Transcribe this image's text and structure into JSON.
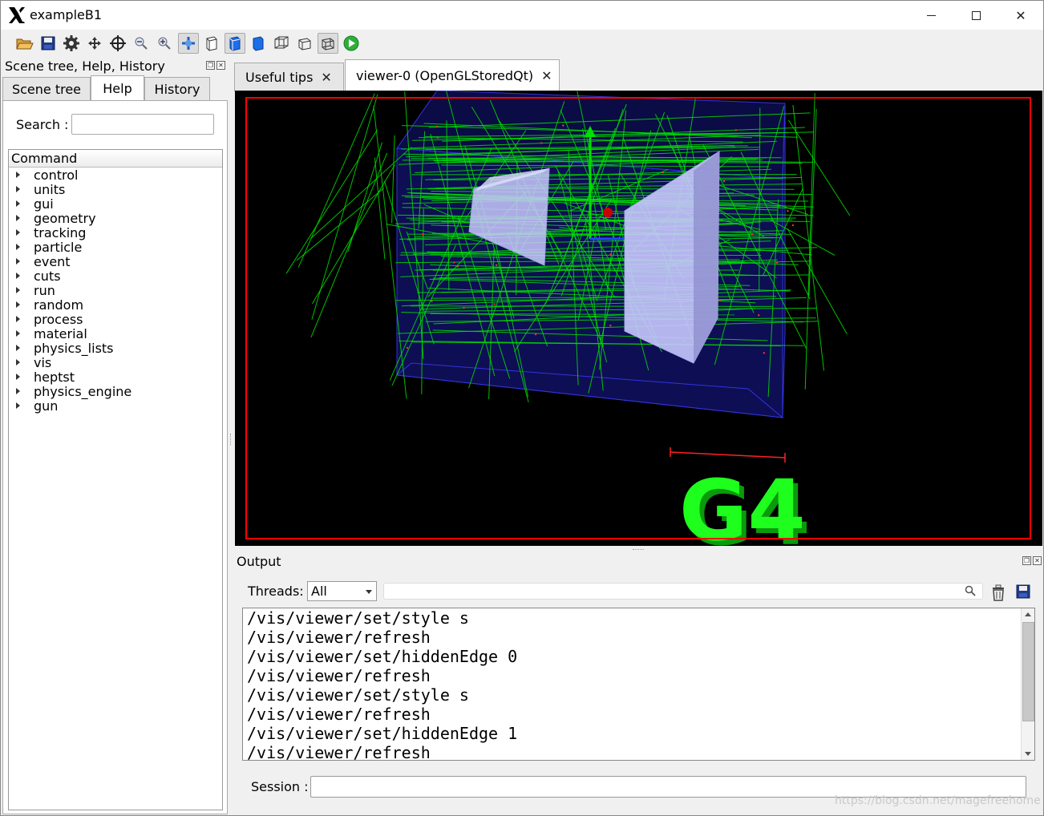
{
  "window": {
    "title": "exampleB1",
    "logo_icon": "x11-logo-icon",
    "controls": {
      "minimize": "—",
      "maximize": "☐",
      "close": "✕"
    }
  },
  "toolbar": {
    "buttons": [
      {
        "name": "open-icon"
      },
      {
        "name": "save-icon"
      },
      {
        "name": "settings-icon"
      },
      {
        "name": "move-icon"
      },
      {
        "name": "pick-icon"
      },
      {
        "name": "zoom-out-icon"
      },
      {
        "name": "zoom-in-icon"
      },
      {
        "name": "rotate-icon",
        "active": true
      },
      {
        "name": "hidden-line-icon"
      },
      {
        "name": "hidden-line-removal-icon",
        "active": true
      },
      {
        "name": "surface-icon"
      },
      {
        "name": "perspective-icon"
      },
      {
        "name": "ortho-icon"
      },
      {
        "name": "wireframe-icon",
        "active": true
      },
      {
        "name": "run-icon"
      }
    ]
  },
  "left_dock": {
    "title": "Scene tree, Help, History",
    "tabs": [
      {
        "label": "Scene tree",
        "selected": false
      },
      {
        "label": "Help",
        "selected": true
      },
      {
        "label": "History",
        "selected": false
      }
    ],
    "search_label": "Search :",
    "search_value": "",
    "tree_header": "Command",
    "commands": [
      "control",
      "units",
      "gui",
      "geometry",
      "tracking",
      "particle",
      "event",
      "cuts",
      "run",
      "random",
      "process",
      "material",
      "physics_lists",
      "vis",
      "heptst",
      "physics_engine",
      "gun"
    ]
  },
  "viewer_tabs": [
    {
      "label": "Useful tips",
      "selected": false,
      "close": "✕"
    },
    {
      "label": "viewer-0 (OpenGLStoredQt)",
      "selected": true,
      "close": "✕"
    }
  ],
  "viewer": {
    "logo_text": "G4",
    "colors": {
      "background": "#000000",
      "frame": "#ff0000",
      "tracks": "#00e000",
      "volumes": "#2222cc",
      "solids": "#c8c8ff",
      "logo": "#1eff1e"
    }
  },
  "output": {
    "title": "Output",
    "threads_label": "Threads:",
    "threads_value": "All",
    "filter_value": "",
    "log": [
      "/vis/viewer/set/style s",
      "/vis/viewer/refresh",
      "/vis/viewer/set/hiddenEdge 0",
      "/vis/viewer/refresh",
      "/vis/viewer/set/style s",
      "/vis/viewer/refresh",
      "/vis/viewer/set/hiddenEdge 1",
      "/vis/viewer/refresh"
    ],
    "session_label": "Session :",
    "session_value": ""
  },
  "watermark": "https://blog.csdn.net/magefreehome"
}
